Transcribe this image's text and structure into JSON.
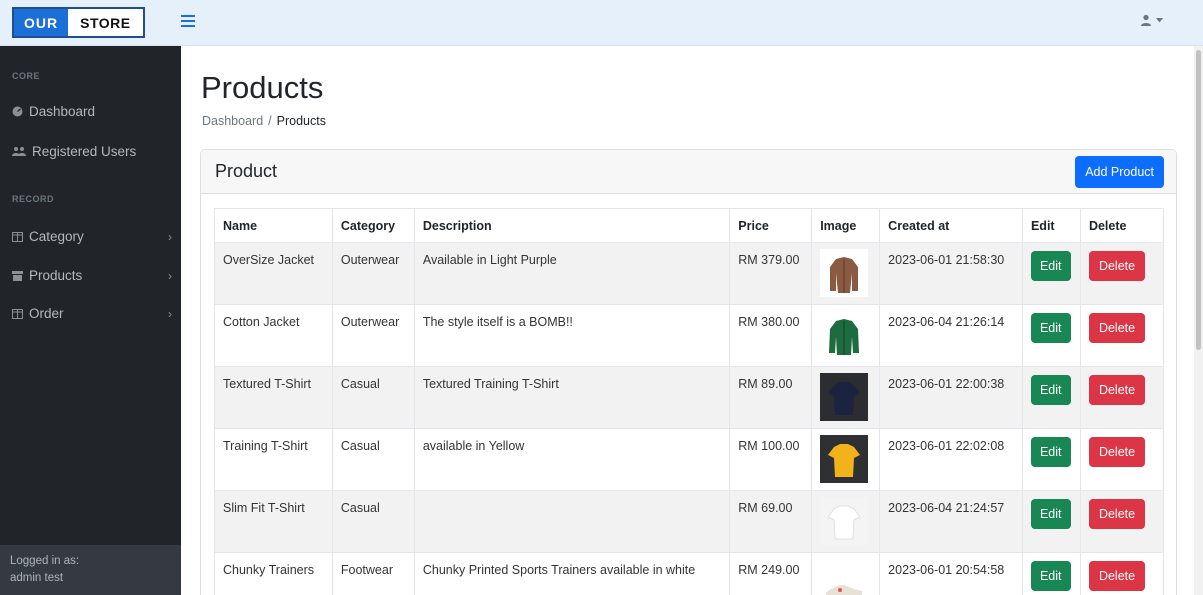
{
  "brand": {
    "part1": "OUR",
    "part2": "STORE"
  },
  "user_menu": {
    "icon": "user-icon"
  },
  "sidebar": {
    "core_heading": "CORE",
    "record_heading": "RECORD",
    "items": [
      {
        "label": "Dashboard",
        "icon": "dashboard-icon"
      },
      {
        "label": "Registered Users",
        "icon": "users-icon"
      },
      {
        "label": "Category",
        "icon": "columns-icon"
      },
      {
        "label": "Products",
        "icon": "products-icon"
      },
      {
        "label": "Order",
        "icon": "columns-icon"
      }
    ],
    "footer": {
      "line1": "Logged in as:",
      "line2": "admin test"
    }
  },
  "page": {
    "title": "Products",
    "breadcrumb": {
      "parent": "Dashboard",
      "separator": "/",
      "current": "Products"
    }
  },
  "card": {
    "title": "Product",
    "add_button": "Add Product"
  },
  "table": {
    "headers": [
      "Name",
      "Category",
      "Description",
      "Price",
      "Image",
      "Created at",
      "Edit",
      "Delete"
    ],
    "rows": [
      {
        "name": "OverSize Jacket",
        "category": "Outerwear",
        "description": "Available in Light Purple",
        "price": "RM 379.00",
        "created": "2023-06-01 21:58:30",
        "image": "brown-jacket",
        "edit": "Edit",
        "delete": "Delete"
      },
      {
        "name": "Cotton Jacket",
        "category": "Outerwear",
        "description": "The style itself is a BOMB!!",
        "price": "RM 380.00",
        "created": "2023-06-04 21:26:14",
        "image": "green-jacket",
        "edit": "Edit",
        "delete": "Delete"
      },
      {
        "name": "Textured T-Shirt",
        "category": "Casual",
        "description": "Textured Training T-Shirt",
        "price": "RM 89.00",
        "created": "2023-06-01 22:00:38",
        "image": "navy-tshirt",
        "edit": "Edit",
        "delete": "Delete"
      },
      {
        "name": "Training T-Shirt",
        "category": "Casual",
        "description": "available in Yellow",
        "price": "RM 100.00",
        "created": "2023-06-01 22:02:08",
        "image": "yellow-tshirt",
        "edit": "Edit",
        "delete": "Delete"
      },
      {
        "name": "Slim Fit T-Shirt",
        "category": "Casual",
        "description": "",
        "price": "RM 69.00",
        "created": "2023-06-04 21:24:57",
        "image": "white-tshirt",
        "edit": "Edit",
        "delete": "Delete"
      },
      {
        "name": "Chunky Trainers",
        "category": "Footwear",
        "description": "Chunky Printed Sports Trainers available in white",
        "price": "RM 249.00",
        "created": "2023-06-01 20:54:58",
        "image": "white-sneaker",
        "edit": "Edit",
        "delete": "Delete"
      }
    ]
  },
  "colors": {
    "topbar": "#e6f0fb",
    "sidebar": "#212529",
    "primary": "#0d6efd",
    "success": "#198754",
    "danger": "#dc3545"
  }
}
